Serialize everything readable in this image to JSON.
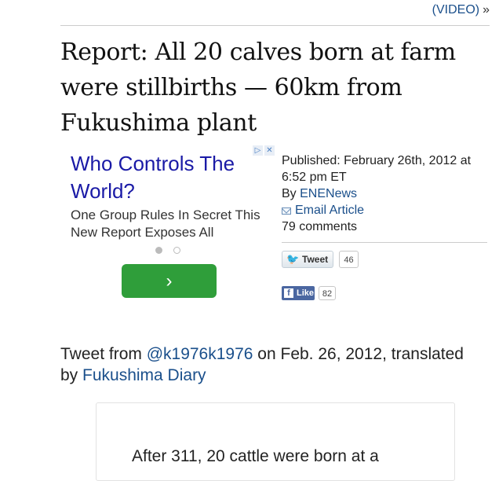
{
  "top_link": {
    "text": "(VIDEO)",
    "raquo": "»"
  },
  "headline": "Report: All 20 calves born at farm were stillbirths — 60km from Fukushima plant",
  "ad": {
    "choices_icons": [
      "▷",
      "✕"
    ],
    "title": "Who Controls The World?",
    "body": "One Group Rules In Secret This New Report Exposes All",
    "cta_glyph": "›"
  },
  "meta": {
    "published": "Published: February 26th, 2012 at 6:52 pm ET",
    "by_prefix": "By ",
    "author": "ENENews",
    "email_label": "Email Article",
    "comments": "79 comments"
  },
  "social": {
    "tweet_label": "Tweet",
    "tweet_count": "46",
    "like_label": "Like",
    "like_count": "82"
  },
  "article": {
    "intro_prefix": "Tweet from ",
    "intro_user": "@k1976k1976",
    "intro_mid": " on Feb. 26, 2012, translated by ",
    "intro_source": "Fukushima Diary",
    "quote_first_line": "After 311, 20 cattle were born at a"
  },
  "colors": {
    "link": "#1a4f8b",
    "ad_title": "#1a1aa6",
    "cta_green": "#2f9e3a",
    "facebook_blue": "#4b67a1"
  }
}
